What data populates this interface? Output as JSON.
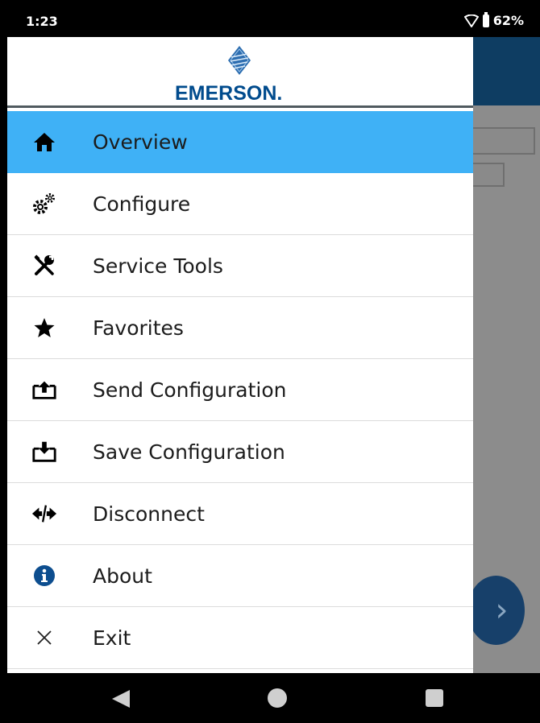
{
  "status_bar": {
    "time": "1:23",
    "battery": "62%",
    "icons": [
      "wifi-icon",
      "battery-icon"
    ]
  },
  "drawer": {
    "logo_text": "EMERSON.",
    "menu": [
      {
        "label": "Overview",
        "icon": "home-icon",
        "active": true
      },
      {
        "label": "Configure",
        "icon": "gears-icon",
        "active": false
      },
      {
        "label": "Service Tools",
        "icon": "tools-icon",
        "active": false
      },
      {
        "label": "Favorites",
        "icon": "star-icon",
        "active": false
      },
      {
        "label": "Send Configuration",
        "icon": "upload-tray-icon",
        "active": false
      },
      {
        "label": "Save Configuration",
        "icon": "download-tray-icon",
        "active": false
      },
      {
        "label": "Disconnect",
        "icon": "disconnect-icon",
        "active": false
      },
      {
        "label": "About",
        "icon": "info-icon",
        "active": false
      },
      {
        "label": "Exit",
        "icon": "close-icon",
        "active": false
      }
    ]
  },
  "colors": {
    "active_item": "#3fb1f6",
    "brand_blue": "#004b8d",
    "header_bg": "#0e3d62",
    "fab": "#17406a"
  },
  "nav_bar": {
    "buttons": [
      "back-icon",
      "home-nav-icon",
      "recents-icon"
    ]
  }
}
